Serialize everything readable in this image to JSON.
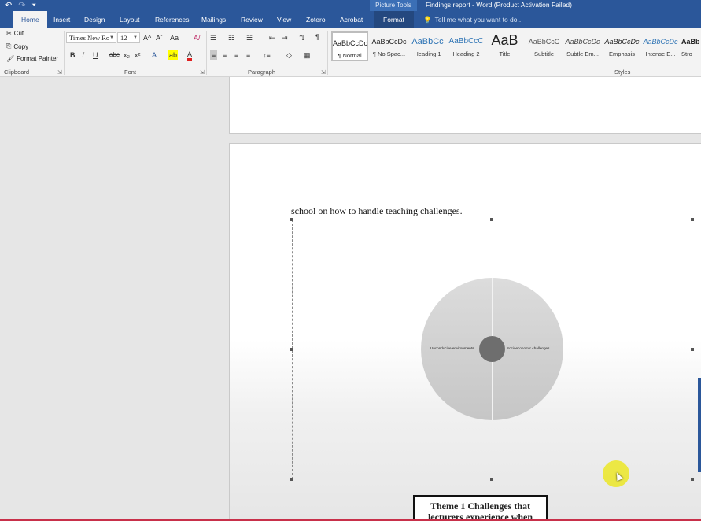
{
  "titlebar": {
    "qat_undo": "↶",
    "qat_redo": "↷",
    "qat_customize": "⏷",
    "picture_tools": "Picture Tools",
    "title": "Findings report - Word (Product Activation Failed)"
  },
  "tabs": [
    {
      "label": "Home"
    },
    {
      "label": "Insert"
    },
    {
      "label": "Design"
    },
    {
      "label": "Layout"
    },
    {
      "label": "References"
    },
    {
      "label": "Mailings"
    },
    {
      "label": "Review"
    },
    {
      "label": "View"
    },
    {
      "label": "Zotero"
    },
    {
      "label": "Acrobat"
    },
    {
      "label": "Format"
    }
  ],
  "tellme": {
    "icon": "lightbulb-icon",
    "text": "Tell me what you want to do..."
  },
  "clipboard": {
    "cut": "Cut",
    "copy": "Copy",
    "format_painter": "Format Painter",
    "label": "Clipboard"
  },
  "font": {
    "name": "Times New Ro",
    "size": "12",
    "label": "Font",
    "grow": "A^",
    "shrink": "Aˇ",
    "case": "Aa",
    "clear": "A/",
    "bold": "B",
    "italic": "I",
    "underline": "U",
    "strike": "abc",
    "subscript": "x₂",
    "superscript": "x²",
    "effects": "A",
    "highlight": "ab",
    "color": "A"
  },
  "paragraph": {
    "label": "Paragraph"
  },
  "styles": {
    "label": "Styles",
    "items": [
      {
        "sample": "AaBbCcDc",
        "name": "¶ Normal"
      },
      {
        "sample": "AaBbCcDc",
        "name": "¶ No Spac..."
      },
      {
        "sample": "AaBbCc",
        "name": "Heading 1"
      },
      {
        "sample": "AaBbCcC",
        "name": "Heading 2"
      },
      {
        "sample": "AaB",
        "name": "Title"
      },
      {
        "sample": "AaBbCcC",
        "name": "Subtitle"
      },
      {
        "sample": "AaBbCcDc",
        "name": "Subtle Em..."
      },
      {
        "sample": "AaBbCcDc",
        "name": "Emphasis"
      },
      {
        "sample": "AaBbCcDc",
        "name": "Intense E..."
      },
      {
        "sample": "AaBb",
        "name": "Stro"
      }
    ]
  },
  "document": {
    "body_text": "school on how to handle teaching challenges.",
    "diagram": {
      "left_label": "Unconducive environments",
      "right_label": "Socioeconomic challenges"
    },
    "theme_box": {
      "line1": "Theme 1 Challenges that",
      "line2": "lecturers experience when"
    }
  },
  "colors": {
    "ribbon_blue": "#2b579a",
    "highlight_yellow": "#ffff00",
    "font_red": "#e02020",
    "cursor_yellow": "#ebe61e"
  }
}
